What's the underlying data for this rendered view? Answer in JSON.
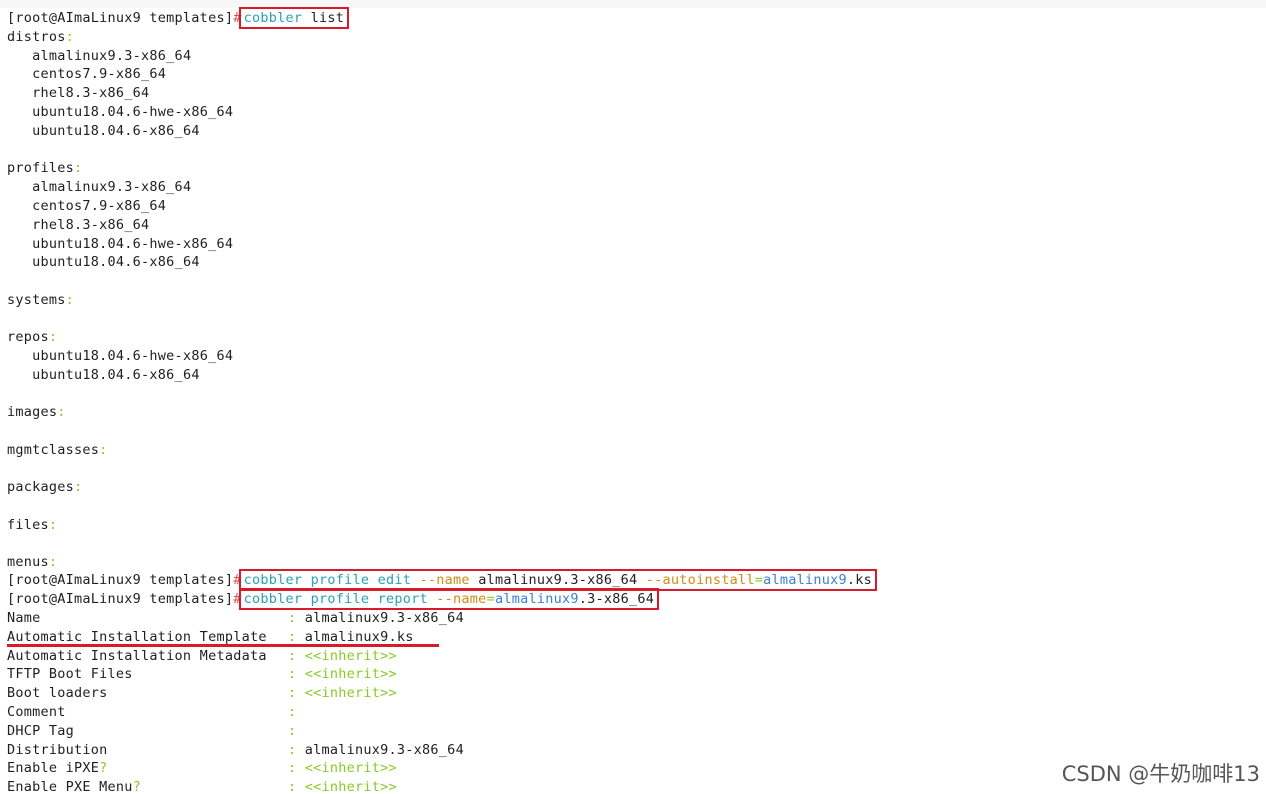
{
  "terminal": {
    "prompt": "[root@AImaLinux9 templates]",
    "hash": "#",
    "command1": "cobbler list",
    "sections": {
      "distros": {
        "label": "distros",
        "items": [
          "almalinux9.3-x86_64",
          "centos7.9-x86_64",
          "rhel8.3-x86_64",
          "ubuntu18.04.6-hwe-x86_64",
          "ubuntu18.04.6-x86_64"
        ]
      },
      "profiles": {
        "label": "profiles",
        "items": [
          "almalinux9.3-x86_64",
          "centos7.9-x86_64",
          "rhel8.3-x86_64",
          "ubuntu18.04.6-hwe-x86_64",
          "ubuntu18.04.6-x86_64"
        ]
      },
      "systems": {
        "label": "systems"
      },
      "repos": {
        "label": "repos",
        "items": [
          "ubuntu18.04.6-hwe-x86_64",
          "ubuntu18.04.6-x86_64"
        ]
      },
      "images": {
        "label": "images"
      },
      "mgmtclasses": {
        "label": "mgmtclasses"
      },
      "packages": {
        "label": "packages"
      },
      "files": {
        "label": "files"
      },
      "menus": {
        "label": "menus"
      }
    },
    "command2": {
      "base": "cobbler profile edit",
      "flag_name": "--name",
      "name_value": "almalinux9.3-x86_64",
      "flag_autoinstall": "--autoinstall",
      "autoinstall_value_main": "almalinux9",
      "autoinstall_value_ext": ".ks"
    },
    "command3": {
      "base": "cobbler profile report",
      "flag_name": "--name",
      "value_main": "almalinux9",
      "value_rest": ".3-x86_64"
    },
    "report": [
      {
        "key": "Name",
        "value": "almalinux9.3-x86_64"
      },
      {
        "key": "Automatic Installation Template",
        "value": "almalinux9.ks"
      },
      {
        "key": "Automatic Installation Metadata",
        "value": "<<inherit>>"
      },
      {
        "key": "TFTP Boot Files",
        "value": "<<inherit>>"
      },
      {
        "key": "Boot loaders",
        "value": "<<inherit>>"
      },
      {
        "key": "Comment",
        "value": ""
      },
      {
        "key": "DHCP Tag",
        "value": ""
      },
      {
        "key": "Distribution",
        "value": "almalinux9.3-x86_64"
      },
      {
        "key": "Enable iPXE",
        "value": "<<inherit>>"
      },
      {
        "key": "Enable PXE Menu",
        "value": "<<inherit>>"
      }
    ]
  },
  "watermark": "CSDN @牛奶咖啡13",
  "colors": {
    "green": "#8ac926",
    "red": "#d9534f",
    "cyan": "#2aa1b3",
    "orange": "#d08a1c",
    "blue": "#3a7fd8",
    "highlight": "#d71b2a"
  }
}
